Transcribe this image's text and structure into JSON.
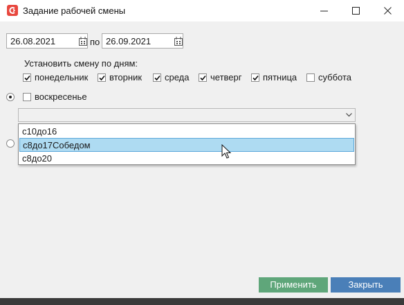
{
  "window": {
    "title": "Задание рабочей смены",
    "icons": [
      "app-logo-icon",
      "minimize-icon",
      "maximize-icon",
      "close-icon"
    ]
  },
  "period": {
    "date_from": "26.08.2021",
    "separator": "по",
    "date_to": "26.09.2021"
  },
  "days_section": {
    "label": "Установить смену по дням:",
    "days": [
      {
        "label": "понедельник",
        "checked": true
      },
      {
        "label": "вторник",
        "checked": true
      },
      {
        "label": "среда",
        "checked": true
      },
      {
        "label": "четверг",
        "checked": true
      },
      {
        "label": "пятница",
        "checked": true
      },
      {
        "label": "суббота",
        "checked": false
      },
      {
        "label": "воскресенье",
        "checked": false
      }
    ]
  },
  "mode_radios": [
    {
      "selected": true
    },
    {
      "selected": false
    }
  ],
  "shift_select": {
    "value": "",
    "options": [
      "с10до16",
      "с8до17Собедом",
      "с8до20"
    ],
    "highlighted_option": "с8до17Собедом"
  },
  "buttons": {
    "apply": "Применить",
    "close": "Закрыть"
  },
  "colors": {
    "apply_button": "#5fa67a",
    "close_button": "#4a7fb8",
    "highlight": "#aedbf2",
    "app_icon": "#e8473e"
  }
}
